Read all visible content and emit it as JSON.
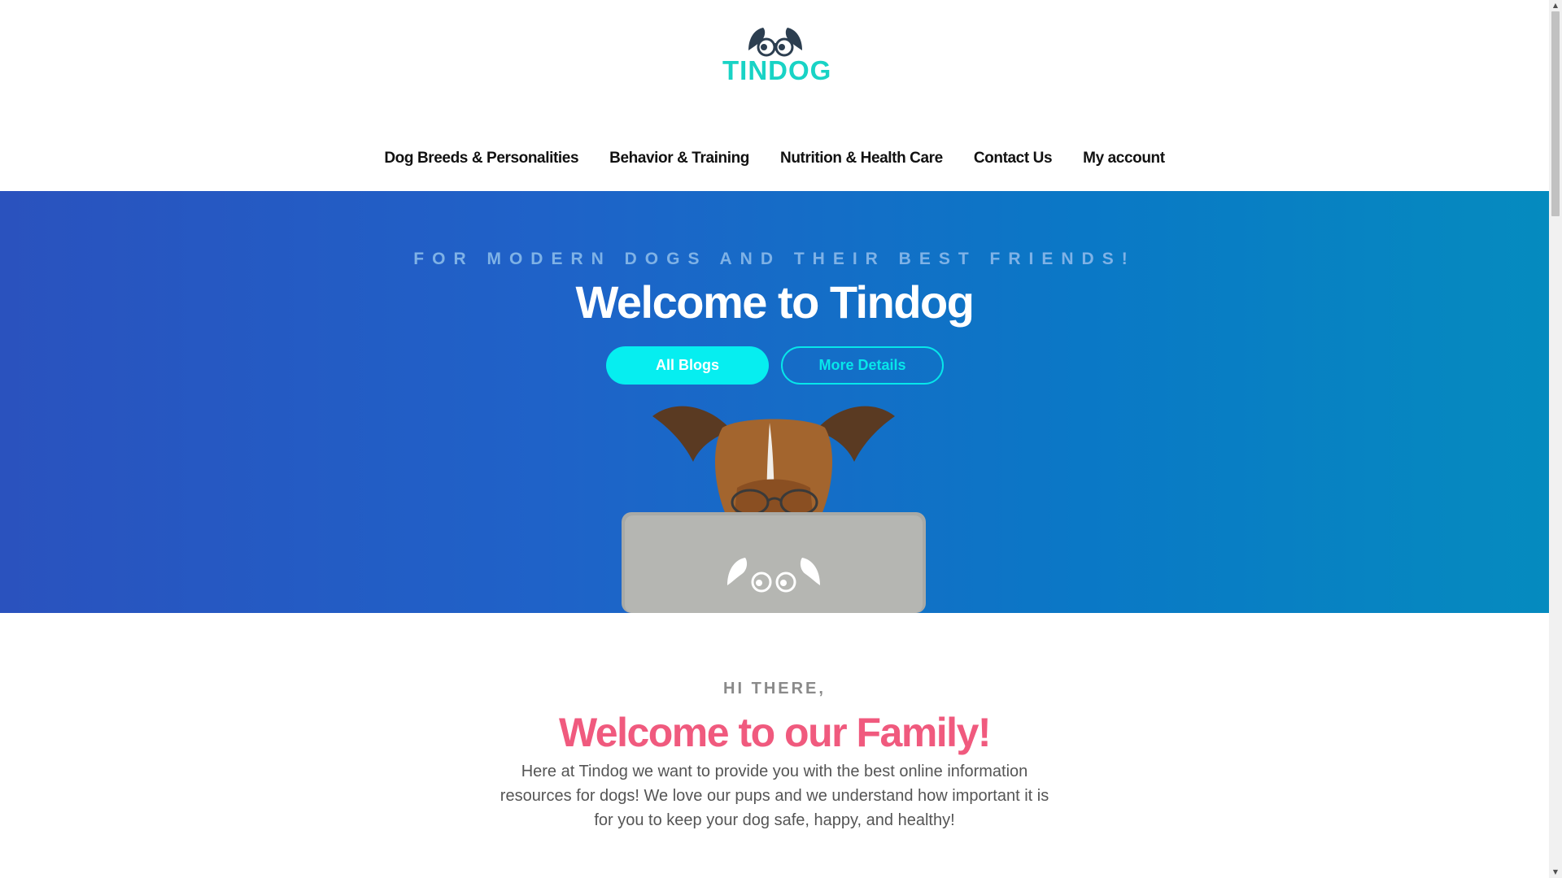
{
  "brand": {
    "name": "TINDOG",
    "logo_icon": "dog-glasses-logo",
    "color": "#19d3c5"
  },
  "nav": {
    "items": [
      {
        "label": "Dog Breeds & Personalities"
      },
      {
        "label": "Behavior & Training"
      },
      {
        "label": "Nutrition & Health Care"
      },
      {
        "label": "Contact Us"
      },
      {
        "label": "My account"
      }
    ]
  },
  "hero": {
    "tagline": "FOR MODERN DOGS AND THEIR BEST FRIENDS!",
    "title": "Welcome to Tindog",
    "primary_button": "All Blogs",
    "secondary_button": "More Details",
    "image": "dog-with-glasses-behind-laptop"
  },
  "family": {
    "eyebrow": "HI THERE,",
    "title": "Welcome to our Family!",
    "text": "Here at Tindog we want to provide you with the best online information resources for dogs! We love our pups and we understand how important it is for you to keep your dog safe, happy, and healthy!"
  },
  "colors": {
    "accent_cyan": "#06eef0",
    "title_pink": "#f05a7e",
    "hero_gradient_start": "#2a52be",
    "hero_gradient_end": "#058bbf"
  }
}
